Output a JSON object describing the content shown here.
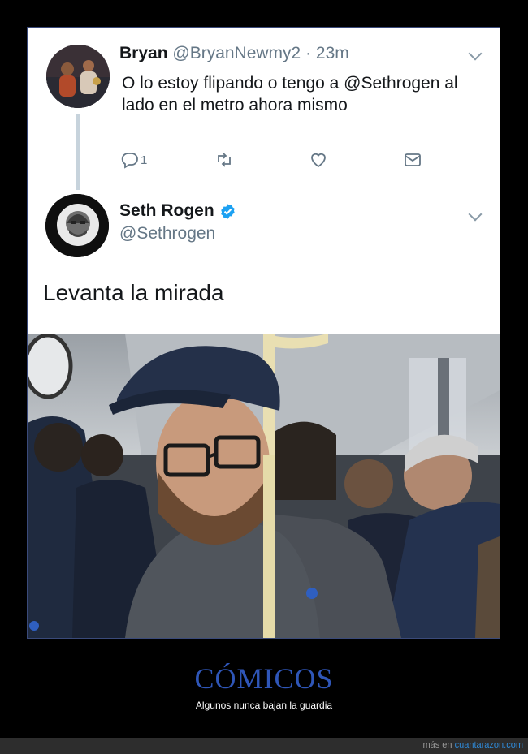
{
  "tweet_reply_source": {
    "author_name": "Bryan",
    "author_handle": "@BryanNewmy2",
    "separator": "·",
    "time": "23m",
    "text": "O lo estoy flipando o tengo a @Sethrogen al lado en el metro ahora mismo",
    "actions": [
      {
        "icon": "reply-icon",
        "count": "1"
      },
      {
        "icon": "retweet-icon",
        "count": ""
      },
      {
        "icon": "like-icon",
        "count": ""
      },
      {
        "icon": "message-icon",
        "count": ""
      }
    ]
  },
  "tweet_reply": {
    "author_name": "Seth Rogen",
    "author_handle": "@Sethrogen",
    "verified": true,
    "text": "Levanta la mirada"
  },
  "photo": {
    "description_icon": "subway-selfie-photo"
  },
  "caption": {
    "title": "CÓMICOS",
    "subtitle": "Algunos nunca bajan la guardia"
  },
  "footer": {
    "prefix": "más en",
    "site": "cuantarazon.com"
  },
  "colors": {
    "accent": "#2f56b8",
    "link": "#2f8ad8",
    "verified": "#1da1f2",
    "muted_text": "#657786"
  }
}
